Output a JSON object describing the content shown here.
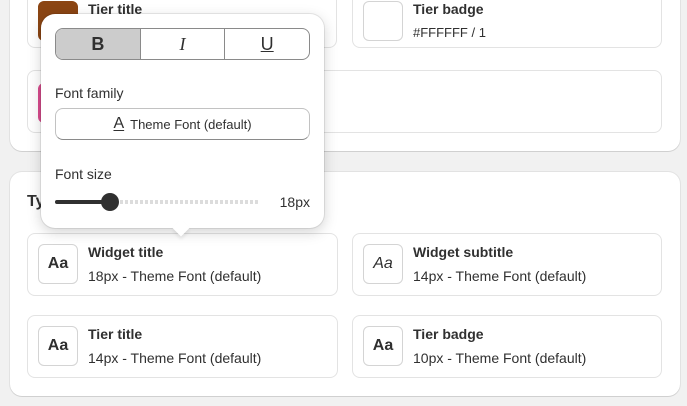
{
  "colors": {
    "tier_title_swatch": "#8B4513",
    "pink_swatch": "#D94C8E"
  },
  "top_section": {
    "tier_title": {
      "title": "Tier title"
    },
    "tier_badge": {
      "title": "Tier badge",
      "value": "#FFFFFF / 1"
    }
  },
  "typography_section": {
    "heading": "Ty",
    "tiles": [
      {
        "sample": "Aa",
        "title": "Widget title",
        "value": "18px - Theme Font (default)"
      },
      {
        "sample": "Aa",
        "title": "Widget subtitle",
        "value": "14px - Theme Font (default)"
      },
      {
        "sample": "Aa",
        "title": "Tier title",
        "value": "14px - Theme Font (default)"
      },
      {
        "sample": "Aa",
        "title": "Tier badge",
        "value": "10px - Theme Font (default)"
      }
    ]
  },
  "popover": {
    "style_options": [
      "B",
      "I",
      "U"
    ],
    "active_style": "B",
    "font_family_label": "Font family",
    "font_family_value": "Theme Font (default)",
    "font_family_icon": "text-font-icon",
    "font_size_label": "Font size",
    "font_size_value": "18px",
    "font_size_fraction": 0.27
  }
}
